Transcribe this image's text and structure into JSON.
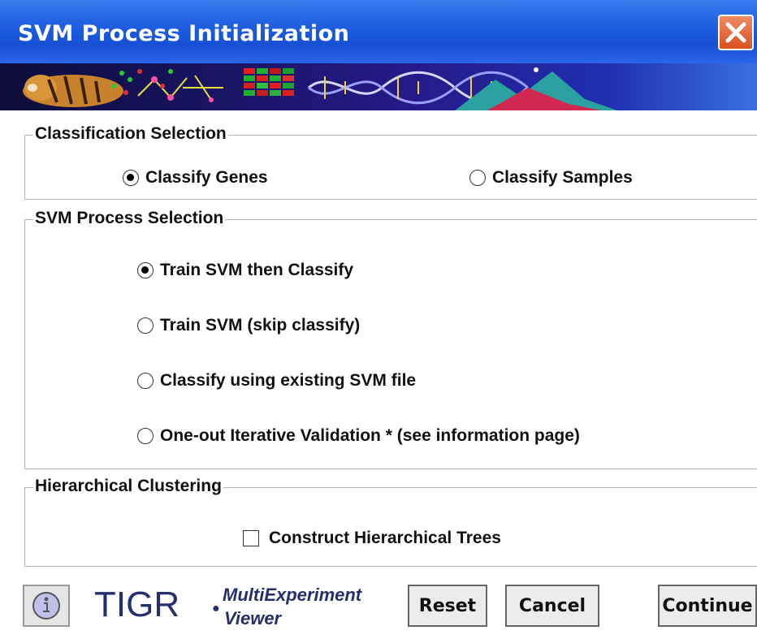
{
  "window": {
    "title": "SVM Process Initialization"
  },
  "classification": {
    "legend": "Classification Selection",
    "options": [
      "Classify Genes",
      "Classify Samples"
    ],
    "selected": "Classify Genes"
  },
  "process": {
    "legend": "SVM Process Selection",
    "options": [
      "Train SVM then Classify",
      "Train SVM (skip classify)",
      "Classify using existing SVM file",
      "One-out Iterative Validation * (see information page)"
    ],
    "selected": "Train SVM then Classify"
  },
  "clustering": {
    "legend": "Hierarchical Clustering",
    "checkbox_label": "Construct Hierarchical Trees",
    "checked": false
  },
  "footer": {
    "logo_name": "TIGR",
    "logo_line1": "MultiExperiment",
    "logo_line2": "Viewer",
    "reset_label": "Reset",
    "cancel_label": "Cancel",
    "continue_label": "Continue"
  },
  "icons": {
    "close": "close-icon",
    "info": "info-icon",
    "banner": "tiger-dna-banner-image"
  },
  "colors": {
    "titlebar": "#1f5fe0",
    "close": "#d9501f",
    "logo": "#24306e"
  }
}
